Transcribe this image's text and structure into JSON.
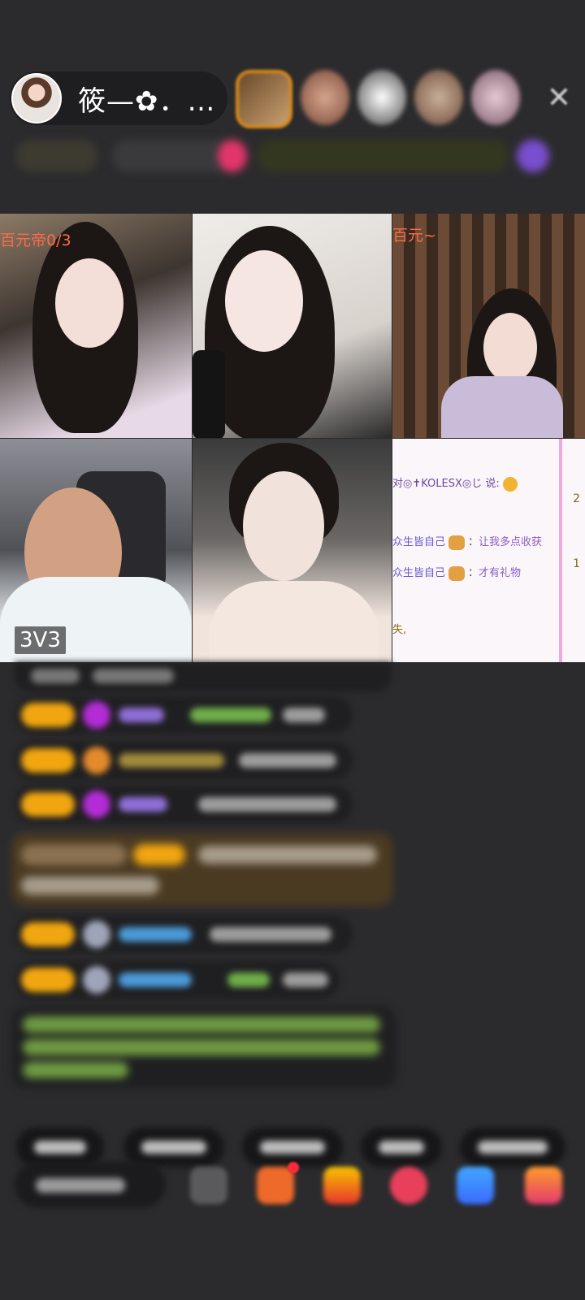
{
  "host": {
    "name": "筱—✿．…"
  },
  "video_grid": {
    "tile1_label": "百元帝0/3",
    "tile3_label": "百元~",
    "tile4_badge": "3V3",
    "chat_panel": {
      "line1_text": "对◎✝KOLESX◎じ 说:",
      "line2_nick": "众生皆自己",
      "line2_msg": "让我多点收获",
      "line3_nick": "众生皆自己",
      "line3_msg": "才有礼物",
      "line4_text": "失,"
    }
  },
  "colors": {
    "background": "#2b2b2d",
    "level_badge": "#f1a60f",
    "chat_purple": "#8e5cc5",
    "accent_orange": "#d98a1a"
  },
  "icons": [
    "close-icon",
    "heart-gift-icon",
    "gift-box-icon",
    "game-icon",
    "share-icon"
  ]
}
